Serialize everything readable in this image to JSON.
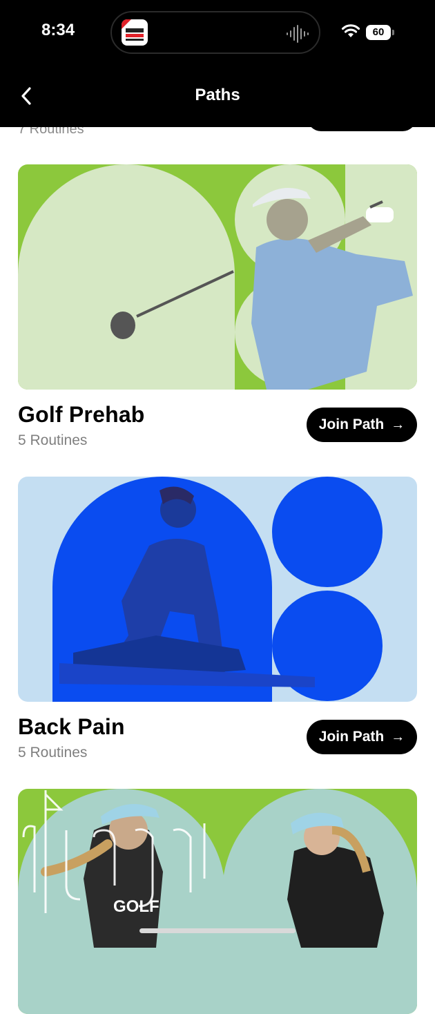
{
  "status_bar": {
    "time": "8:34",
    "battery": "60",
    "live_activity_app": "Pardon The Interruption"
  },
  "header": {
    "title": "Paths",
    "back_icon": "chevron-left-icon"
  },
  "previous_card": {
    "routines": "7 Routines"
  },
  "paths": [
    {
      "title": "Golf Prehab",
      "routines": "5 Routines",
      "button": "Join Path",
      "accent": "#8cc83c",
      "tint": "#d6e8c4"
    },
    {
      "title": "Back Pain",
      "routines": "5 Routines",
      "button": "Join Path",
      "accent": "#0a4cf0",
      "tint": "#c4def2"
    },
    {
      "title": "",
      "routines": "",
      "button": "",
      "accent": "#8cc83c",
      "tint": "#a8d2c8",
      "watermark": "plugged in GOLF"
    }
  ],
  "colors": {
    "header_bg": "#000000",
    "button_bg": "#000000",
    "subtext": "#7f7f7f"
  }
}
